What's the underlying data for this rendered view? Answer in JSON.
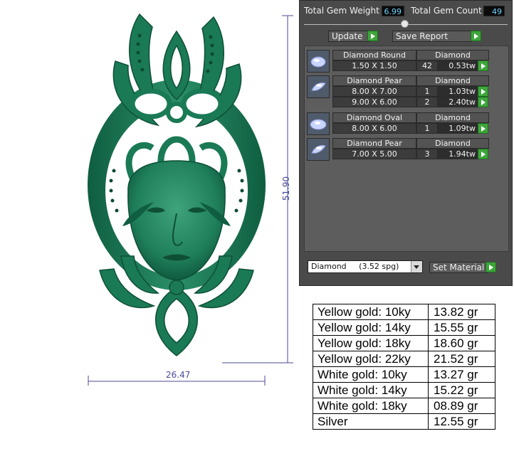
{
  "dimensions": {
    "width_label": "26.47",
    "height_label": "51.90"
  },
  "panel": {
    "total_weight_label": "Total Gem Weight",
    "total_weight_value": "6.99",
    "total_count_label": "Total Gem Count",
    "total_count_value": "49",
    "update_label": "Update",
    "save_report_label": "Save Report",
    "gems": [
      {
        "icon": "round-gem-icon",
        "shape": "Diamond Round",
        "material": "Diamond",
        "rows": [
          {
            "size": "1.50 X 1.50",
            "count": "42",
            "weight": "0.53tw"
          }
        ]
      },
      {
        "icon": "pear-gem-icon",
        "shape": "Diamond Pear",
        "material": "Diamond",
        "rows": [
          {
            "size": "8.00 X 7.00",
            "count": "1",
            "weight": "1.03tw"
          },
          {
            "size": "9.00 X 6.00",
            "count": "2",
            "weight": "2.40tw"
          }
        ]
      },
      {
        "icon": "oval-gem-icon",
        "shape": "Diamond Oval",
        "material": "Diamond",
        "rows": [
          {
            "size": "8.00 X 6.00",
            "count": "1",
            "weight": "1.09tw"
          }
        ]
      },
      {
        "icon": "pear-gem-icon",
        "shape": "Diamond Pear",
        "material": "Diamond",
        "rows": [
          {
            "size": "7.00 X 5.00",
            "count": "3",
            "weight": "1.94tw"
          }
        ]
      }
    ],
    "material_select": "Diamond     (3.52 spg)",
    "set_material_label": "Set Material"
  },
  "weights": [
    {
      "metal": "Yellow gold: 10ky",
      "weight": "13.82 gr"
    },
    {
      "metal": "Yellow gold: 14ky",
      "weight": "15.55 gr"
    },
    {
      "metal": "Yellow gold: 18ky",
      "weight": "18.60 gr"
    },
    {
      "metal": "Yellow gold: 22ky",
      "weight": "21.52 gr"
    },
    {
      "metal": "White gold: 10ky",
      "weight": "13.27 gr"
    },
    {
      "metal": "White gold: 14ky",
      "weight": "15.22 gr"
    },
    {
      "metal": "White gold: 18ky",
      "weight": "08.89 gr"
    },
    {
      "metal": "Silver",
      "weight": "12.55 gr"
    }
  ],
  "colors": {
    "model": "#1d7a58",
    "panel": "#4a4a4a",
    "accent": "#3ea53b",
    "value_text": "#6fd0ff"
  }
}
